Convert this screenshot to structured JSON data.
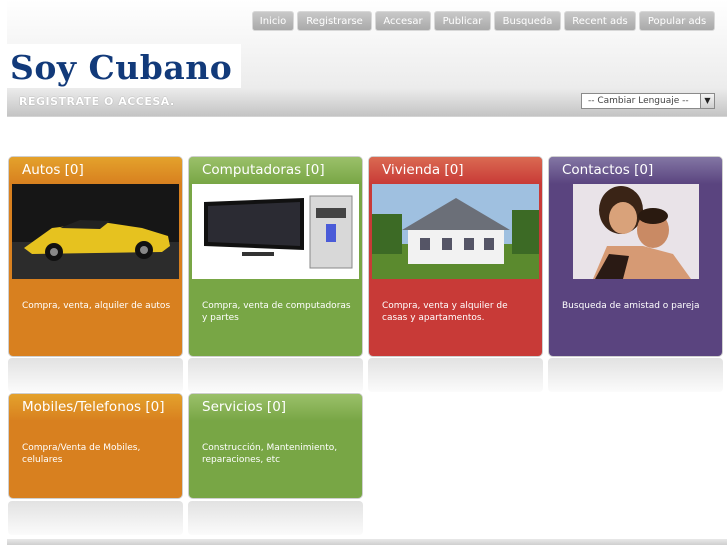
{
  "nav": [
    "Inicio",
    "Registrarse",
    "Accesar",
    "Publicar",
    "Busqueda",
    "Recent ads",
    "Popular ads"
  ],
  "logo": {
    "text": "Soy Cubano"
  },
  "bar": {
    "text": "REGISTRATE O ACCESA.",
    "language_select": "-- Cambiar Lenguaje --"
  },
  "cards": [
    {
      "title": "Autos [0]",
      "desc": "Compra, venta, alquiler de autos",
      "color": "#d8801f",
      "title_color": "#e4a22c"
    },
    {
      "title": "Computadoras [0]",
      "desc": "Compra, venta de computadoras y partes",
      "color": "#78a645",
      "title_color": "#9bc06a"
    },
    {
      "title": "Vivienda [0]",
      "desc": "Compra, venta y alquiler de casas y apartamentos.",
      "color": "#c83a37",
      "title_color": "#da6a52"
    },
    {
      "title": "Contactos [0]",
      "desc": "Busqueda de amistad o pareja",
      "color": "#5a447f",
      "title_color": "#8376a4"
    },
    {
      "title": "Mobiles/Telefonos [0]",
      "desc": "Compra/Venta de Mobiles, celulares",
      "color": "#d8801f",
      "title_color": "#e4a22c"
    },
    {
      "title": "Servicios [0]",
      "desc": "Construcción, Mantenimiento, reparaciones, etc",
      "color": "#78a645",
      "title_color": "#9bc06a"
    }
  ]
}
